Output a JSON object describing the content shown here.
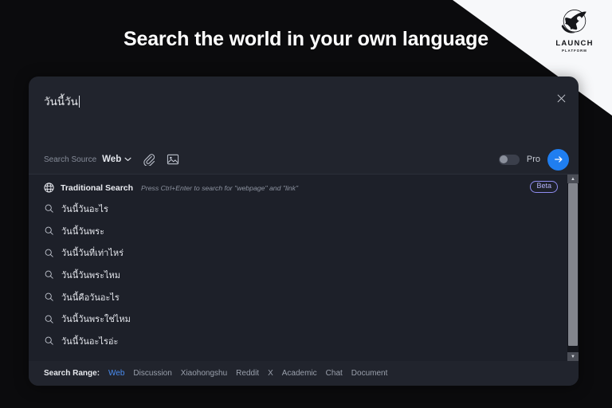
{
  "brand": {
    "logo_icon": "rocket-icon",
    "name": "LAUNCH",
    "tagline": "PLATFORM",
    "accent_color": "#1f7ef0"
  },
  "headline": "Search the world in your own language",
  "search_panel": {
    "query": "วันนี้วัน",
    "close_icon": "close-icon",
    "toolbar": {
      "source_label": "Search Source",
      "source_value": "Web",
      "chevron_icon": "chevron-down-icon",
      "attach_icon": "paperclip-icon",
      "image_icon": "image-icon",
      "pro_label": "Pro",
      "pro_enabled": false,
      "submit_icon": "arrow-right-icon"
    },
    "dropdown": {
      "traditional": {
        "icon": "globe-icon",
        "label": "Traditional Search",
        "hint": "Press Ctrl+Enter to search for \"webpage\" and \"link\"",
        "badge": "Beta",
        "badge_color": "#b3b0f7"
      },
      "suggestions": [
        {
          "icon": "search-icon",
          "text": "วันนี้วันอะไร"
        },
        {
          "icon": "search-icon",
          "text": "วันนี้วันพระ"
        },
        {
          "icon": "search-icon",
          "text": "วันนี้วันที่เท่าไหร่"
        },
        {
          "icon": "search-icon",
          "text": "วันนี้วันพระไหม"
        },
        {
          "icon": "search-icon",
          "text": "วันนี้คือวันอะไร"
        },
        {
          "icon": "search-icon",
          "text": "วันนี้วันพระใช่ไหม"
        },
        {
          "icon": "search-icon",
          "text": "วันนี้วันอะไรอ่ะ"
        }
      ]
    },
    "footer": {
      "label": "Search Range:",
      "items": [
        {
          "label": "Web",
          "active": true
        },
        {
          "label": "Discussion",
          "active": false
        },
        {
          "label": "Xiaohongshu",
          "active": false
        },
        {
          "label": "Reddit",
          "active": false
        },
        {
          "label": "X",
          "active": false
        },
        {
          "label": "Academic",
          "active": false
        },
        {
          "label": "Chat",
          "active": false
        },
        {
          "label": "Document",
          "active": false
        }
      ]
    }
  }
}
